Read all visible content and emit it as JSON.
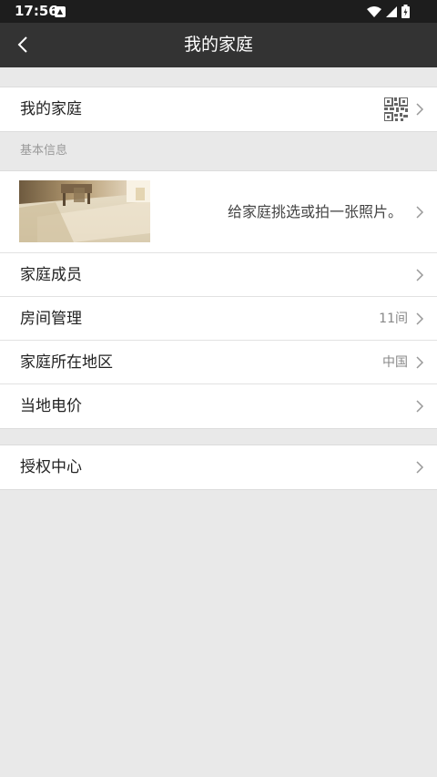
{
  "status_bar": {
    "time": "17:56"
  },
  "app_bar": {
    "title": "我的家庭"
  },
  "family_card": {
    "label": "我的家庭"
  },
  "basic_info": {
    "section_title": "基本信息",
    "photo_hint": "给家庭挑选或拍一张照片。",
    "rows": [
      {
        "label": "家庭成员",
        "value": ""
      },
      {
        "label": "房间管理",
        "value": "11间"
      },
      {
        "label": "家庭所在地区",
        "value": "中国"
      },
      {
        "label": "当地电价",
        "value": ""
      }
    ]
  },
  "auth_card": {
    "label": "授权中心"
  },
  "colors": {
    "status_bar": "#1d1d1d",
    "app_bar": "#333333",
    "background": "#e9e9e9",
    "card": "#ffffff",
    "secondary_text": "#888888"
  }
}
